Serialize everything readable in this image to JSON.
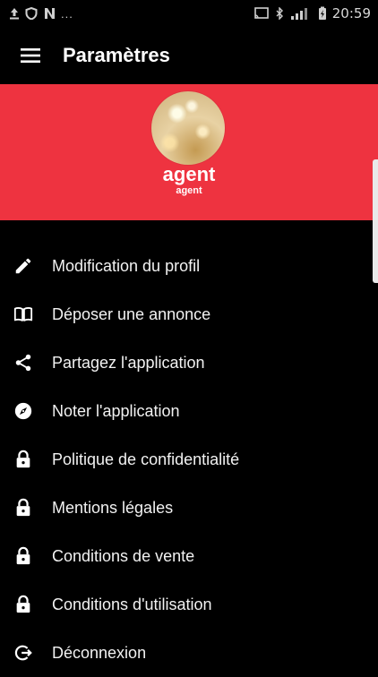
{
  "status_bar": {
    "time": "20:59",
    "left_indicator": "...",
    "icons": [
      "upload-icon",
      "shield-icon",
      "n-icon",
      "cast-icon",
      "bluetooth-icon",
      "signal-icon",
      "battery-charging-icon"
    ]
  },
  "app_bar": {
    "title": "Paramètres",
    "menu_icon": "hamburger-icon"
  },
  "header": {
    "background_color": "#ee3340",
    "user_name": "agent",
    "user_subtitle": "agent"
  },
  "menu": {
    "items": [
      {
        "label": "Modification du profil",
        "icon": "pencil-icon"
      },
      {
        "label": "Déposer une annonce",
        "icon": "book-icon"
      },
      {
        "label": "Partagez l'application",
        "icon": "share-icon"
      },
      {
        "label": "Noter l'application",
        "icon": "compass-icon"
      },
      {
        "label": "Politique de confidentialité",
        "icon": "lock-icon"
      },
      {
        "label": "Mentions légales",
        "icon": "lock-icon"
      },
      {
        "label": "Conditions de vente",
        "icon": "lock-icon"
      },
      {
        "label": "Conditions d'utilisation",
        "icon": "lock-icon"
      },
      {
        "label": "Déconnexion",
        "icon": "logout-icon"
      }
    ]
  }
}
